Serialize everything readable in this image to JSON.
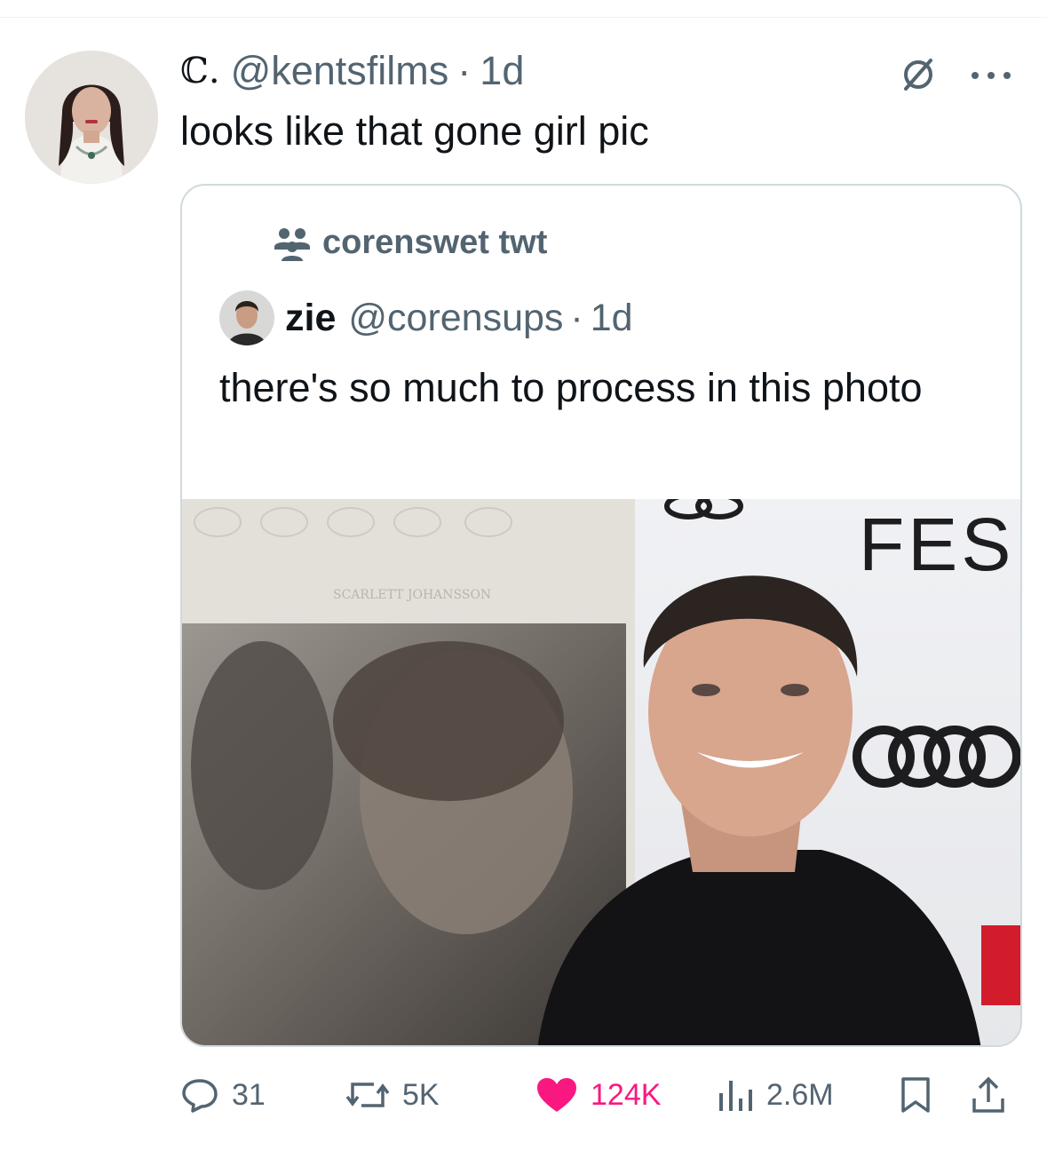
{
  "post": {
    "display_name": "ℂ.",
    "handle": "@kentsfilms",
    "separator": "·",
    "time": "1d",
    "text": "looks like that gone girl pic"
  },
  "quote": {
    "community": "corenswet twt",
    "display_name": "zie",
    "handle": "@corensups",
    "separator": "·",
    "time": "1d",
    "text": "there's so much to process in this photo",
    "photo": {
      "sign_text": "FES",
      "poster_text": "SCARLETT JOHANSSON"
    }
  },
  "actions": {
    "replies": "31",
    "reposts": "5K",
    "likes": "124K",
    "views": "2.6M"
  },
  "colors": {
    "text": "#0f1419",
    "secondary": "#536471",
    "like": "#f91880",
    "border": "#cfd9de"
  },
  "icons": [
    "grok-icon",
    "more-icon",
    "community-icon",
    "reply-icon",
    "repost-icon",
    "heart-icon",
    "views-icon",
    "bookmark-icon",
    "share-icon"
  ]
}
